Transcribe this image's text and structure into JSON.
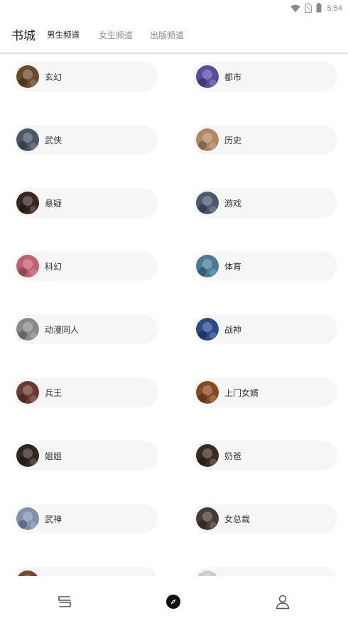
{
  "status_bar": {
    "time": "5:54",
    "icons": [
      "wifi-icon",
      "sim-card-icon",
      "battery-icon"
    ]
  },
  "header": {
    "title": "书城",
    "tabs": [
      {
        "label": "男生频道",
        "active": true
      },
      {
        "label": "女生频道",
        "active": false
      },
      {
        "label": "出版频道",
        "active": false
      }
    ]
  },
  "categories": [
    {
      "label": "玄幻",
      "avatar_color": "#6b4a2a"
    },
    {
      "label": "都市",
      "avatar_color": "#5a4aa0"
    },
    {
      "label": "武侠",
      "avatar_color": "#4a5566"
    },
    {
      "label": "历史",
      "avatar_color": "#b08860"
    },
    {
      "label": "悬疑",
      "avatar_color": "#3a2520"
    },
    {
      "label": "游戏",
      "avatar_color": "#4a5a70"
    },
    {
      "label": "科幻",
      "avatar_color": "#c06070"
    },
    {
      "label": "体育",
      "avatar_color": "#4a7a9a"
    },
    {
      "label": "动漫同人",
      "avatar_color": "#8a8a8a"
    },
    {
      "label": "战神",
      "avatar_color": "#2a4a8a"
    },
    {
      "label": "兵王",
      "avatar_color": "#6a3a30"
    },
    {
      "label": "上门女婿",
      "avatar_color": "#8a4a20"
    },
    {
      "label": "姐姐",
      "avatar_color": "#30251f"
    },
    {
      "label": "奶爸",
      "avatar_color": "#3a2a20"
    },
    {
      "label": "武神",
      "avatar_color": "#8090b0"
    },
    {
      "label": "女总裁",
      "avatar_color": "#4a3a35"
    },
    {
      "label": "",
      "avatar_color": "#7a4a30"
    },
    {
      "label": "",
      "avatar_color": "#cccccc"
    }
  ],
  "bottom_nav": {
    "items": [
      {
        "icon": "bookshelf-icon",
        "active": false
      },
      {
        "icon": "compass-icon",
        "active": true
      },
      {
        "icon": "profile-icon",
        "active": false
      }
    ]
  },
  "colors": {
    "item_background": "#f6f6f6",
    "text_primary": "#222222",
    "text_secondary": "#8a8a8a"
  }
}
